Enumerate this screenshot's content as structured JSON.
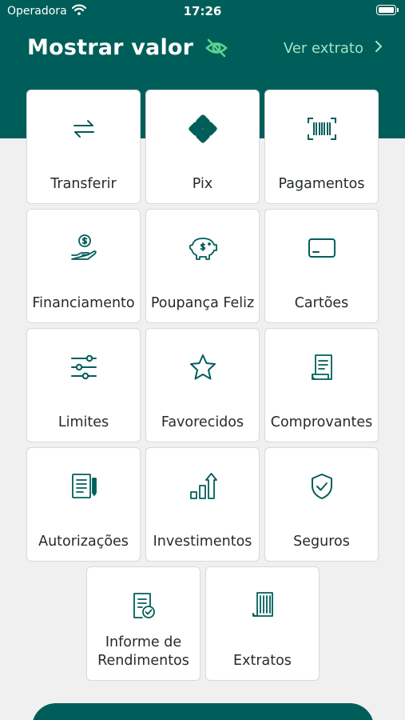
{
  "status_bar": {
    "carrier": "Operadora",
    "time": "17:26"
  },
  "header": {
    "title": "Mostrar valor",
    "statement_link": "Ver extrato"
  },
  "menu": [
    {
      "id": "transferir",
      "label": "Transferir",
      "icon": "transfer-icon"
    },
    {
      "id": "pix",
      "label": "Pix",
      "icon": "pix-icon"
    },
    {
      "id": "pagamentos",
      "label": "Pagamentos",
      "icon": "barcode-icon"
    },
    {
      "id": "financiamento",
      "label": "Financiamento",
      "icon": "hand-money-icon"
    },
    {
      "id": "poupanca",
      "label": "Poupança Feliz",
      "icon": "piggy-bank-icon"
    },
    {
      "id": "cartoes",
      "label": "Cartões",
      "icon": "credit-card-icon"
    },
    {
      "id": "limites",
      "label": "Limites",
      "icon": "sliders-icon"
    },
    {
      "id": "favorecidos",
      "label": "Favorecidos",
      "icon": "star-icon"
    },
    {
      "id": "comprovantes",
      "label": "Comprovantes",
      "icon": "receipt-icon"
    },
    {
      "id": "autorizacoes",
      "label": "Autorizações",
      "icon": "document-pen-icon"
    },
    {
      "id": "investimentos",
      "label": "Investimentos",
      "icon": "growth-chart-icon"
    },
    {
      "id": "seguros",
      "label": "Seguros",
      "icon": "shield-check-icon"
    },
    {
      "id": "informe",
      "label": "Informe de Rendimentos",
      "icon": "document-check-icon"
    },
    {
      "id": "extratos",
      "label": "Extratos",
      "icon": "statement-icon"
    }
  ],
  "colors": {
    "primary": "#005e5a",
    "accent": "#9fe3c4",
    "icon": "#005e5a"
  }
}
